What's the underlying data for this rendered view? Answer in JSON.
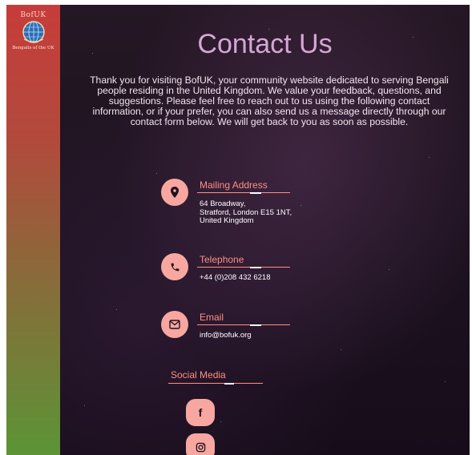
{
  "brand": {
    "title": "BofUK",
    "subtitle": "Bengalis of the UK"
  },
  "page": {
    "title": "Contact Us",
    "intro": "Thank you for visiting BofUK, your community website dedicated to serving Bengali people residing in the United Kingdom. We value your feedback, questions, and suggestions. Please feel free to reach out to us using the following contact information, or if your prefer, you can also send us a message directly through our contact form below. We will get back to you as soon as possible."
  },
  "contact": {
    "mailing": {
      "title": "Mailing Address",
      "line1": "64 Broadway,",
      "line2": "Stratford, London E15 1NT,",
      "line3": "United Kingdom",
      "icon": "location-pin-icon"
    },
    "telephone": {
      "title": "Telephone",
      "value": "+44 (0)208 432 6218",
      "icon": "phone-icon"
    },
    "email": {
      "title": "Email",
      "value": "info@bofuk.org",
      "icon": "envelope-icon"
    }
  },
  "social": {
    "title": "Social Media",
    "items": [
      {
        "icon": "facebook-icon",
        "glyph": "f"
      },
      {
        "icon": "instagram-icon"
      }
    ]
  },
  "colors": {
    "accent": "#ff8f84",
    "icon_bg": "#f7a7a0",
    "title": "#d6a6d6",
    "sidebar_top": "#c63c3a",
    "sidebar_bottom": "#5c9436"
  }
}
